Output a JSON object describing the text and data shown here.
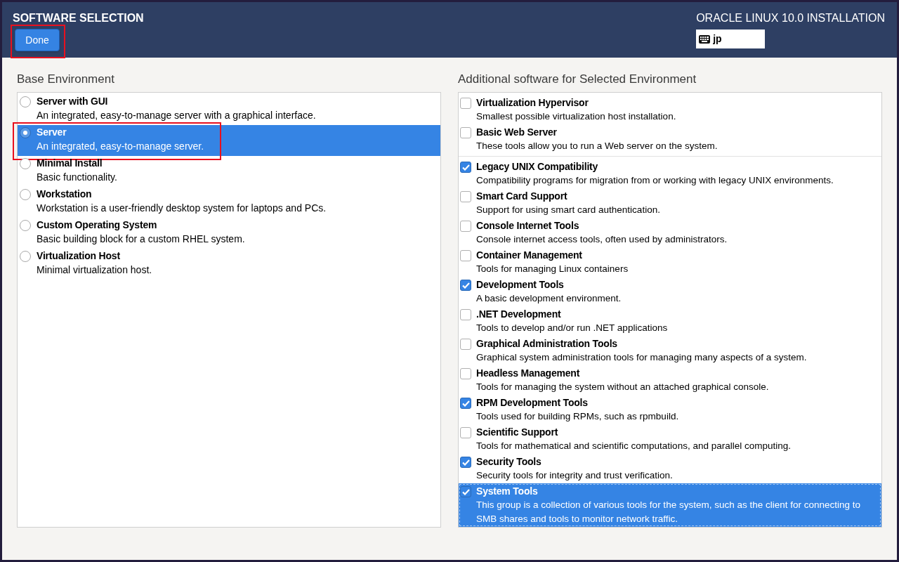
{
  "header": {
    "title": "SOFTWARE SELECTION",
    "done_button": {
      "label": "Done",
      "highlighted": true
    },
    "product": "ORACLE LINUX 10.0 INSTALLATION",
    "keyboard_layout": "jp"
  },
  "base_environment": {
    "heading": "Base Environment",
    "items": [
      {
        "name": "Server with GUI",
        "description": "An integrated, easy-to-manage server with a graphical interface.",
        "selected": false,
        "highlighted": false
      },
      {
        "name": "Server",
        "description": "An integrated, easy-to-manage server.",
        "selected": true,
        "highlighted": true
      },
      {
        "name": "Minimal Install",
        "description": "Basic functionality.",
        "selected": false,
        "highlighted": false
      },
      {
        "name": "Workstation",
        "description": "Workstation is a user-friendly desktop system for laptops and PCs.",
        "selected": false,
        "highlighted": false
      },
      {
        "name": "Custom Operating System",
        "description": "Basic building block for a custom RHEL system.",
        "selected": false,
        "highlighted": false
      },
      {
        "name": "Virtualization Host",
        "description": "Minimal virtualization host.",
        "selected": false,
        "highlighted": false
      }
    ]
  },
  "additional_software": {
    "heading": "Additional software for Selected Environment",
    "groups": [
      {
        "items": [
          {
            "name": "Virtualization Hypervisor",
            "description": "Smallest possible virtualization host installation.",
            "checked": false,
            "selected": false
          },
          {
            "name": "Basic Web Server",
            "description": "These tools allow you to run a Web server on the system.",
            "checked": false,
            "selected": false
          }
        ]
      },
      {
        "items": [
          {
            "name": "Legacy UNIX Compatibility",
            "description": "Compatibility programs for migration from or working with legacy UNIX environments.",
            "checked": true,
            "selected": false
          },
          {
            "name": "Smart Card Support",
            "description": "Support for using smart card authentication.",
            "checked": false,
            "selected": false
          },
          {
            "name": "Console Internet Tools",
            "description": "Console internet access tools, often used by administrators.",
            "checked": false,
            "selected": false
          },
          {
            "name": "Container Management",
            "description": "Tools for managing Linux containers",
            "checked": false,
            "selected": false
          },
          {
            "name": "Development Tools",
            "description": "A basic development environment.",
            "checked": true,
            "selected": false
          },
          {
            "name": ".NET Development",
            "description": "Tools to develop and/or run .NET applications",
            "checked": false,
            "selected": false
          },
          {
            "name": "Graphical Administration Tools",
            "description": "Graphical system administration tools for managing many aspects of a system.",
            "checked": false,
            "selected": false
          },
          {
            "name": "Headless Management",
            "description": "Tools for managing the system without an attached graphical console.",
            "checked": false,
            "selected": false
          },
          {
            "name": "RPM Development Tools",
            "description": "Tools used for building RPMs, such as rpmbuild.",
            "checked": true,
            "selected": false
          },
          {
            "name": "Scientific Support",
            "description": "Tools for mathematical and scientific computations, and parallel computing.",
            "checked": false,
            "selected": false
          },
          {
            "name": "Security Tools",
            "description": "Security tools for integrity and trust verification.",
            "checked": true,
            "selected": false
          },
          {
            "name": "System Tools",
            "description": "This group is a collection of various tools for the system, such as the client for connecting to SMB shares and tools to monitor network traffic.",
            "checked": true,
            "selected": true
          }
        ]
      }
    ]
  }
}
